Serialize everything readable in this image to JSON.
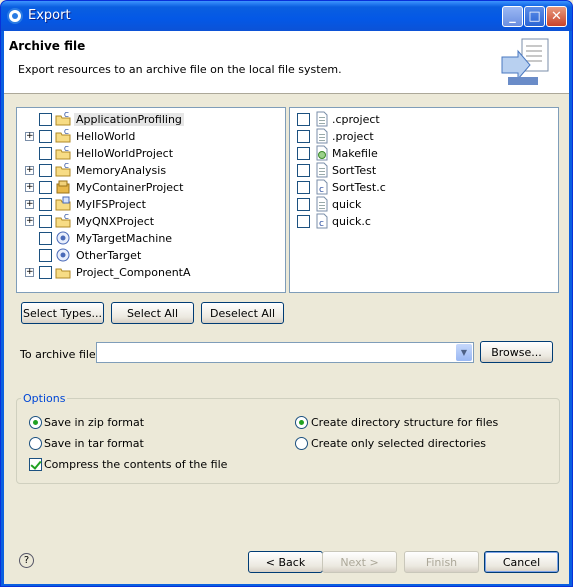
{
  "window": {
    "title": "Export",
    "minimize": "_",
    "maximize": "□",
    "close": "✕"
  },
  "header": {
    "title": "Archive file",
    "description": "Export resources to an archive file on the local file system."
  },
  "projects": [
    {
      "name": "ApplicationProfiling",
      "expandable": false,
      "icon": "project-folder-c-icon",
      "selected": true
    },
    {
      "name": "HelloWorld",
      "expandable": true,
      "icon": "project-folder-c-icon",
      "selected": false
    },
    {
      "name": "HelloWorldProject",
      "expandable": false,
      "icon": "project-folder-c-icon",
      "selected": false
    },
    {
      "name": "MemoryAnalysis",
      "expandable": true,
      "icon": "project-folder-c-icon",
      "selected": false
    },
    {
      "name": "MyContainerProject",
      "expandable": true,
      "icon": "container-project-icon",
      "selected": false
    },
    {
      "name": "MyIFSProject",
      "expandable": true,
      "icon": "ifs-project-icon",
      "selected": false
    },
    {
      "name": "MyQNXProject",
      "expandable": true,
      "icon": "project-folder-c-icon",
      "selected": false
    },
    {
      "name": "MyTargetMachine",
      "expandable": false,
      "icon": "target-icon",
      "selected": false
    },
    {
      "name": "OtherTarget",
      "expandable": false,
      "icon": "target-icon",
      "selected": false
    },
    {
      "name": "Project_ComponentA",
      "expandable": true,
      "icon": "project-folder-icon",
      "selected": false
    }
  ],
  "files": [
    {
      "name": ".cproject",
      "icon": "text-file-icon"
    },
    {
      "name": ".project",
      "icon": "text-file-icon"
    },
    {
      "name": "Makefile",
      "icon": "makefile-icon"
    },
    {
      "name": "SortTest",
      "icon": "text-file-icon"
    },
    {
      "name": "SortTest.c",
      "icon": "c-file-icon"
    },
    {
      "name": "quick",
      "icon": "text-file-icon"
    },
    {
      "name": "quick.c",
      "icon": "c-file-icon"
    }
  ],
  "selection_buttons": {
    "select_types": "Select Types...",
    "select_all": "Select All",
    "deselect_all": "Deselect All"
  },
  "archive": {
    "label": "To archive file:",
    "value": "",
    "browse": "Browse..."
  },
  "options": {
    "title": "Options",
    "zip": {
      "label": "Save in zip format",
      "checked": true
    },
    "tar": {
      "label": "Save in tar format",
      "checked": false
    },
    "compress": {
      "label": "Compress the contents of the file",
      "checked": true
    },
    "create_structure": {
      "label": "Create directory structure for files",
      "checked": true
    },
    "create_selected": {
      "label": "Create only selected directories",
      "checked": false
    }
  },
  "footer": {
    "help": "?",
    "back": "< Back",
    "next": "Next >",
    "finish": "Finish",
    "cancel": "Cancel"
  }
}
